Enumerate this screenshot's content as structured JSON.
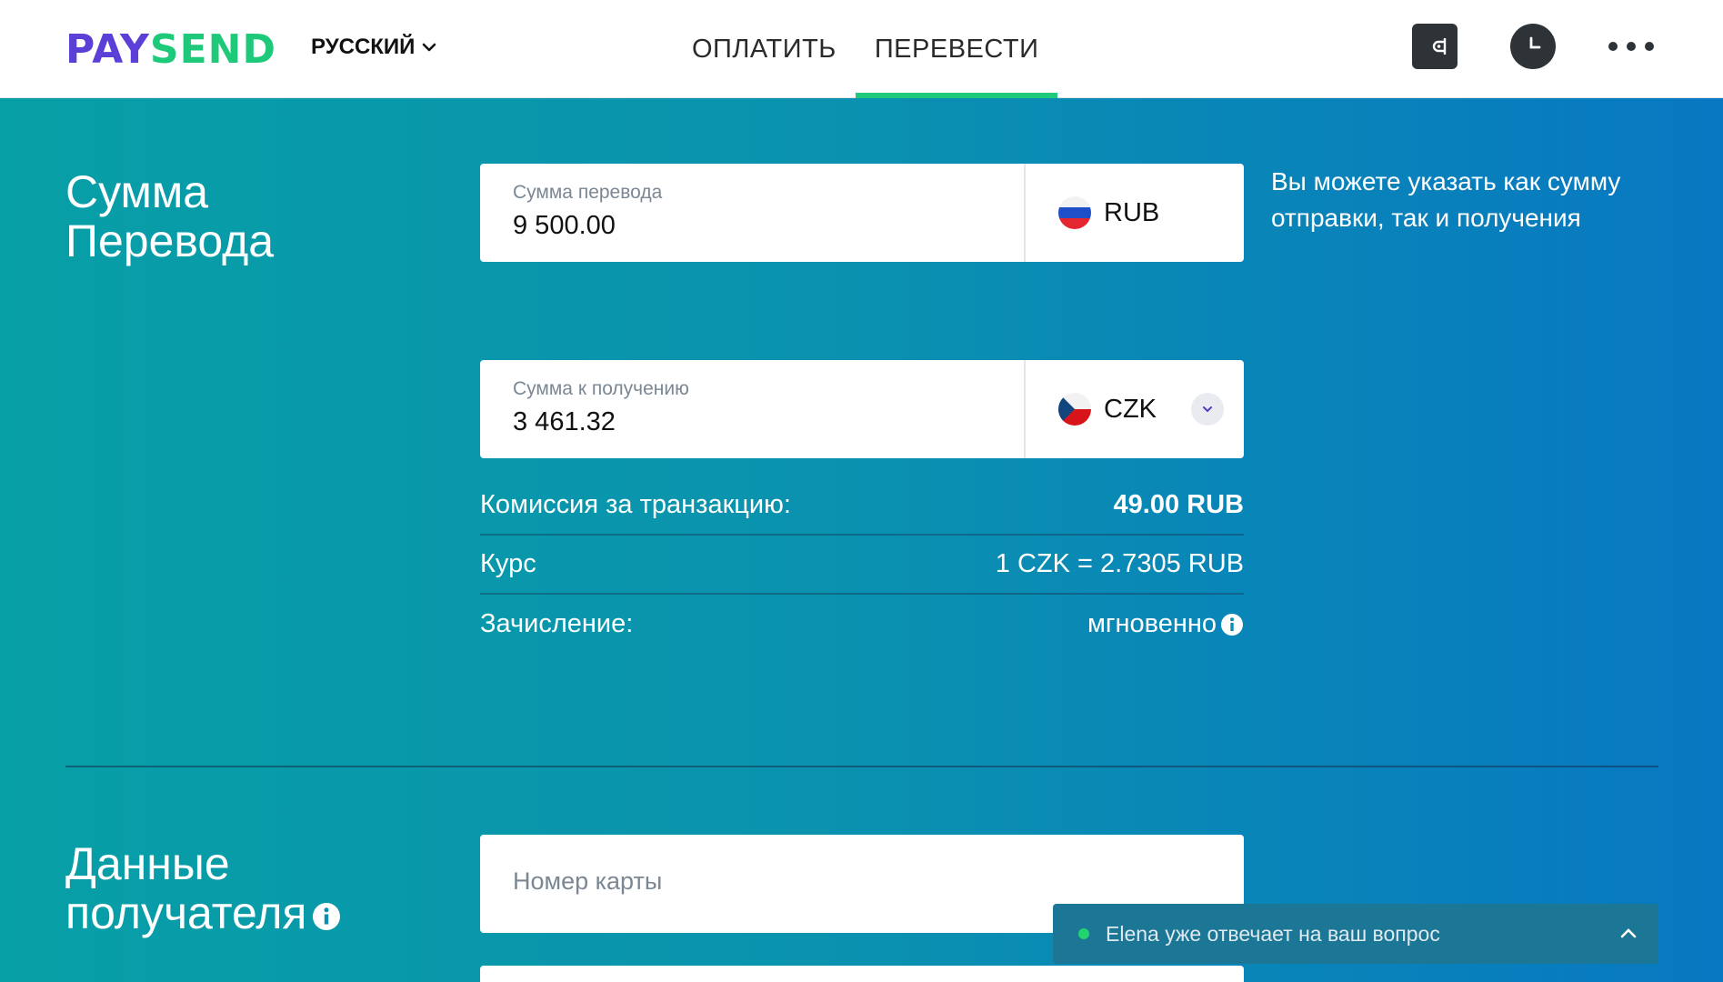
{
  "header": {
    "logo_pay": "PAY",
    "logo_send": "SEND",
    "language": "РУССКИЙ",
    "nav": [
      {
        "label": "ОПЛАТИТЬ",
        "active": false
      },
      {
        "label": "ПЕРЕВЕСТИ",
        "active": true
      }
    ],
    "icons": [
      "wallet-icon",
      "clock-icon",
      "more-icon"
    ]
  },
  "transfer": {
    "title": "Сумма Перевода",
    "send": {
      "label": "Сумма перевода",
      "value": "9 500.00",
      "currency": "RUB"
    },
    "receive": {
      "label": "Сумма к получению",
      "value": "3 461.32",
      "currency": "CZK"
    },
    "hint": "Вы можете указать как сумму отправки, так и получения",
    "fee": {
      "label": "Комиссия за транзакцию:",
      "value": "49.00 RUB"
    },
    "rate": {
      "label": "Курс",
      "value": "1 CZK = 2.7305 RUB"
    },
    "delivery": {
      "label": "Зачисление:",
      "value": "мгновенно"
    }
  },
  "recipient": {
    "title_line1": "Данные",
    "title_line2": "получателя",
    "card_placeholder": "Номер карты"
  },
  "chat": {
    "text": "Elena уже отвечает на ваш вопрос"
  },
  "colors": {
    "brand_purple": "#5b3fd6",
    "brand_green": "#1fc97a",
    "header_icon_dark": "#2e3338"
  }
}
